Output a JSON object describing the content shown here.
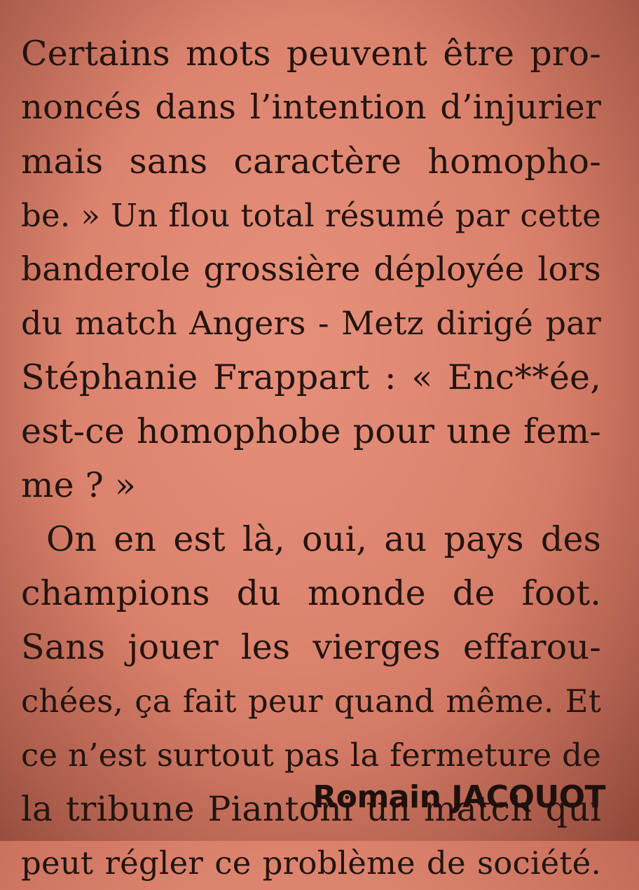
{
  "article": {
    "paragraph1": [
      "Certains mots peuvent être pro-",
      "noncés dans l’intention d’injurier",
      "mais sans caractère homopho-",
      "be. » Un flou total résumé par cette",
      "banderole grossière déployée lors",
      "du match Angers - Metz dirigé par",
      "Stéphanie Frappart : « Enc**ée,",
      "est-ce homophobe pour une fem-",
      "me ? »"
    ],
    "paragraph2": [
      "On en est là, oui, au pays des",
      "champions du monde de foot.",
      "Sans jouer les vierges effarou-",
      "chées, ça fait peur quand même. Et",
      "ce n’est surtout pas la fermeture de",
      "la tribune Piantoni un match qui",
      "peut régler ce problème de société."
    ],
    "byline": "Romain JACQUOT"
  }
}
